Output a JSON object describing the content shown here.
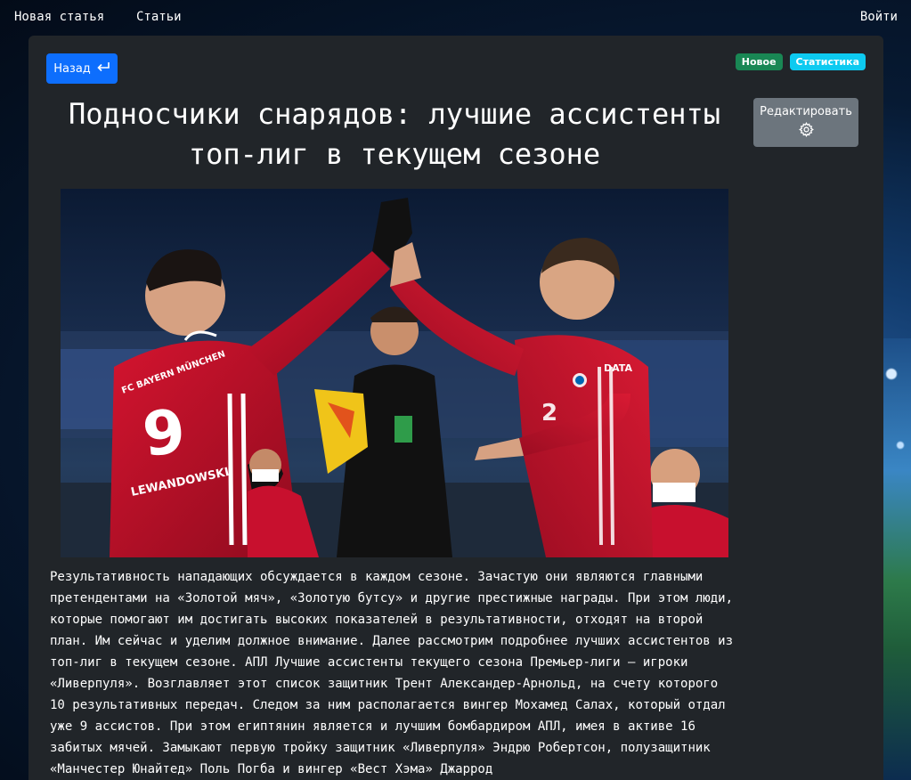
{
  "nav": {
    "new_article": "Новая статья",
    "articles": "Статьи",
    "login": "Войти"
  },
  "article": {
    "back_label": "Назад",
    "back_icon": "return-arrow-icon",
    "badges": [
      "Новое",
      "Статистика"
    ],
    "edit_label": "Редактировать",
    "edit_icon": "gear-icon",
    "title": "Подносчики снарядов: лучшие ассистенты топ-лиг в текущем сезоне",
    "image": {
      "jersey_left_text": "FC BAYERN MÜNCHEN",
      "jersey_left_number": "9",
      "jersey_left_name": "LEWANDOWSKI",
      "jersey_right_number": "2",
      "sponsor": "DATA"
    },
    "body": "Результативность нападающих обсуждается в каждом сезоне. Зачастую они являются главными претендентами на «Золотой мяч», «Золотую бутсу» и другие престижные награды. При этом люди, которые помогают им достигать высоких показателей в результативности, отходят на второй план. Им сейчас и уделим должное внимание. Далее рассмотрим подробнее лучших ассистентов из топ-лиг в текущем сезоне. АПЛ Лучшие ассистенты текущего сезона Премьер-лиги – игроки «Ливерпуля». Возглавляет этот список защитник Трент Александер-Арнольд, на счету которого 10 результативных передач. Следом за ним располагается вингер Мохамед Салах, который отдал уже 9 ассистов. При этом египтянин является и лучшим бомбардиром АПЛ, имея в активе 16 забитых мячей. Замыкают первую тройку защитник «Ливерпуля» Эндрю Робертсон, полузащитник «Манчестер Юнайтед» Поль Погба и вингер «Вест Хэма» Джаррод"
  },
  "colors": {
    "primary": "#0d6efd",
    "success": "#198754",
    "info": "#0dcaf0",
    "secondary": "#6c757d",
    "card": "#212529",
    "kit_red": "#c8102e"
  }
}
